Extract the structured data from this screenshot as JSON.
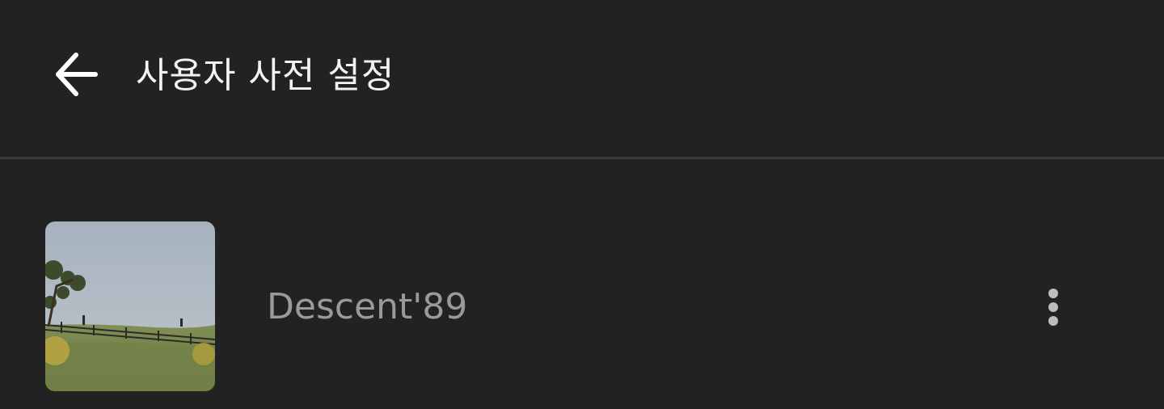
{
  "header": {
    "title": "사용자 사전 설정",
    "back_icon": "arrow-left-icon"
  },
  "presets": [
    {
      "name": "Descent'89",
      "thumbnail_icon": "landscape-photo-thumbnail",
      "menu_icon": "more-vertical-icon"
    }
  ],
  "colors": {
    "background": "#222222",
    "divider": "#3b3b3b",
    "title_text": "#f2f2f2",
    "item_text": "#9a9a9a"
  }
}
